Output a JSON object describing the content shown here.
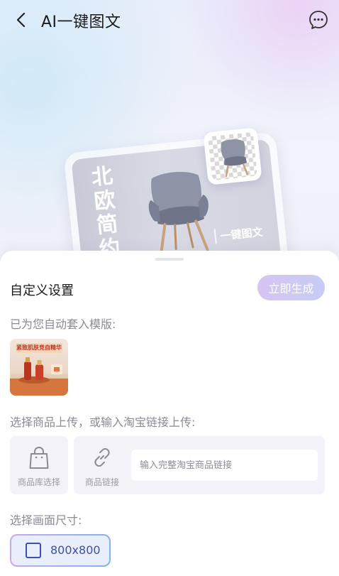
{
  "header": {
    "title": "AI一键图文",
    "back_icon": "chevron-left-icon",
    "chat_icon": "chat-bubble-icon"
  },
  "hero": {
    "card_text": "北欧简约",
    "promo_text": "一键图文"
  },
  "sheet": {
    "title": "自定义设置",
    "generate_button": "立即生成",
    "template_label": "已为您自动套入模版:",
    "template_banner": "紧致肌肤竞自精华",
    "upload_label": "选择商品上传，或输入淘宝链接上传:",
    "library_tile_label": "商品库选择",
    "link_tile_label": "商品链接",
    "link_input_value": "",
    "link_input_placeholder": "输入完整淘宝商品链接",
    "size_label": "选择画面尺寸:",
    "size_option": "800x800"
  },
  "colors": {
    "accent": "#3e4fb0",
    "generate_gradient_start": "#d7c4f3",
    "generate_gradient_end": "#c6ccf5",
    "tile_background": "#f2f2f8"
  }
}
